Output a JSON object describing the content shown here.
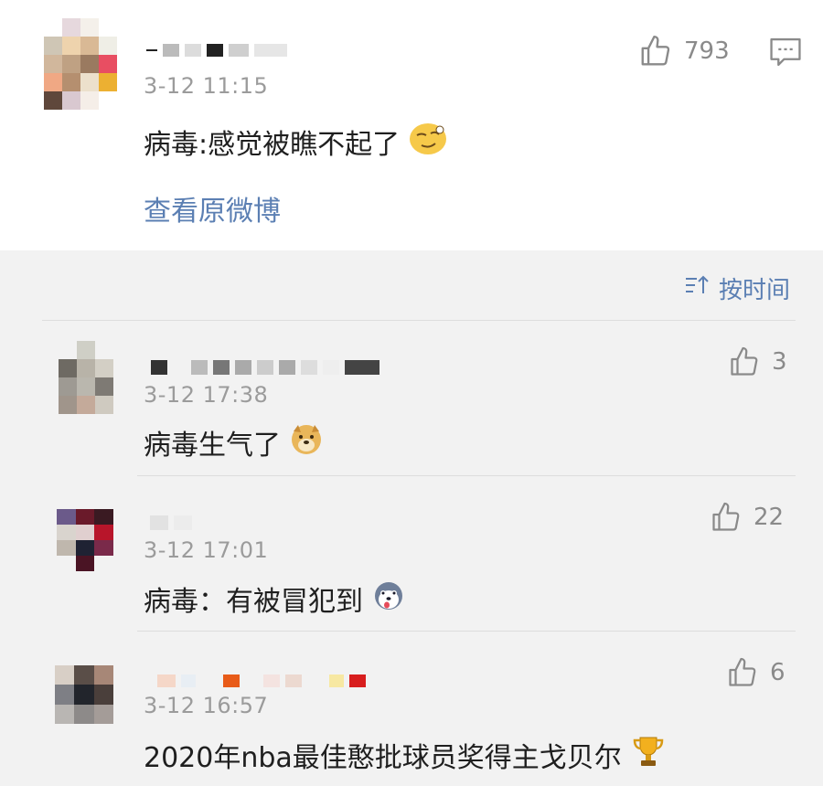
{
  "post": {
    "timestamp": "3-12 11:15",
    "like_count": "793",
    "text": "病毒:感觉被瞧不起了",
    "emoji": "smirk-emoji",
    "link_label": "查看原微博"
  },
  "sort": {
    "label": "按时间",
    "icon": "sort-icon"
  },
  "comments": [
    {
      "timestamp": "3-12 17:38",
      "likes": "3",
      "text": "病毒生气了",
      "emoji": "doge-emoji"
    },
    {
      "timestamp": "3-12 17:01",
      "likes": "22",
      "text": "病毒：有被冒犯到",
      "emoji": "husky-emoji"
    },
    {
      "timestamp": "3-12 16:57",
      "likes": "6",
      "text": "2020年nba最佳憨批球员奖得主戈贝尔",
      "emoji": "trophy-emoji"
    }
  ],
  "colors": {
    "link": "#5b7fb3",
    "timestamp": "#9b9b9b",
    "text": "#1f1f1f",
    "background": "#f2f2f2",
    "card": "#ffffff"
  }
}
